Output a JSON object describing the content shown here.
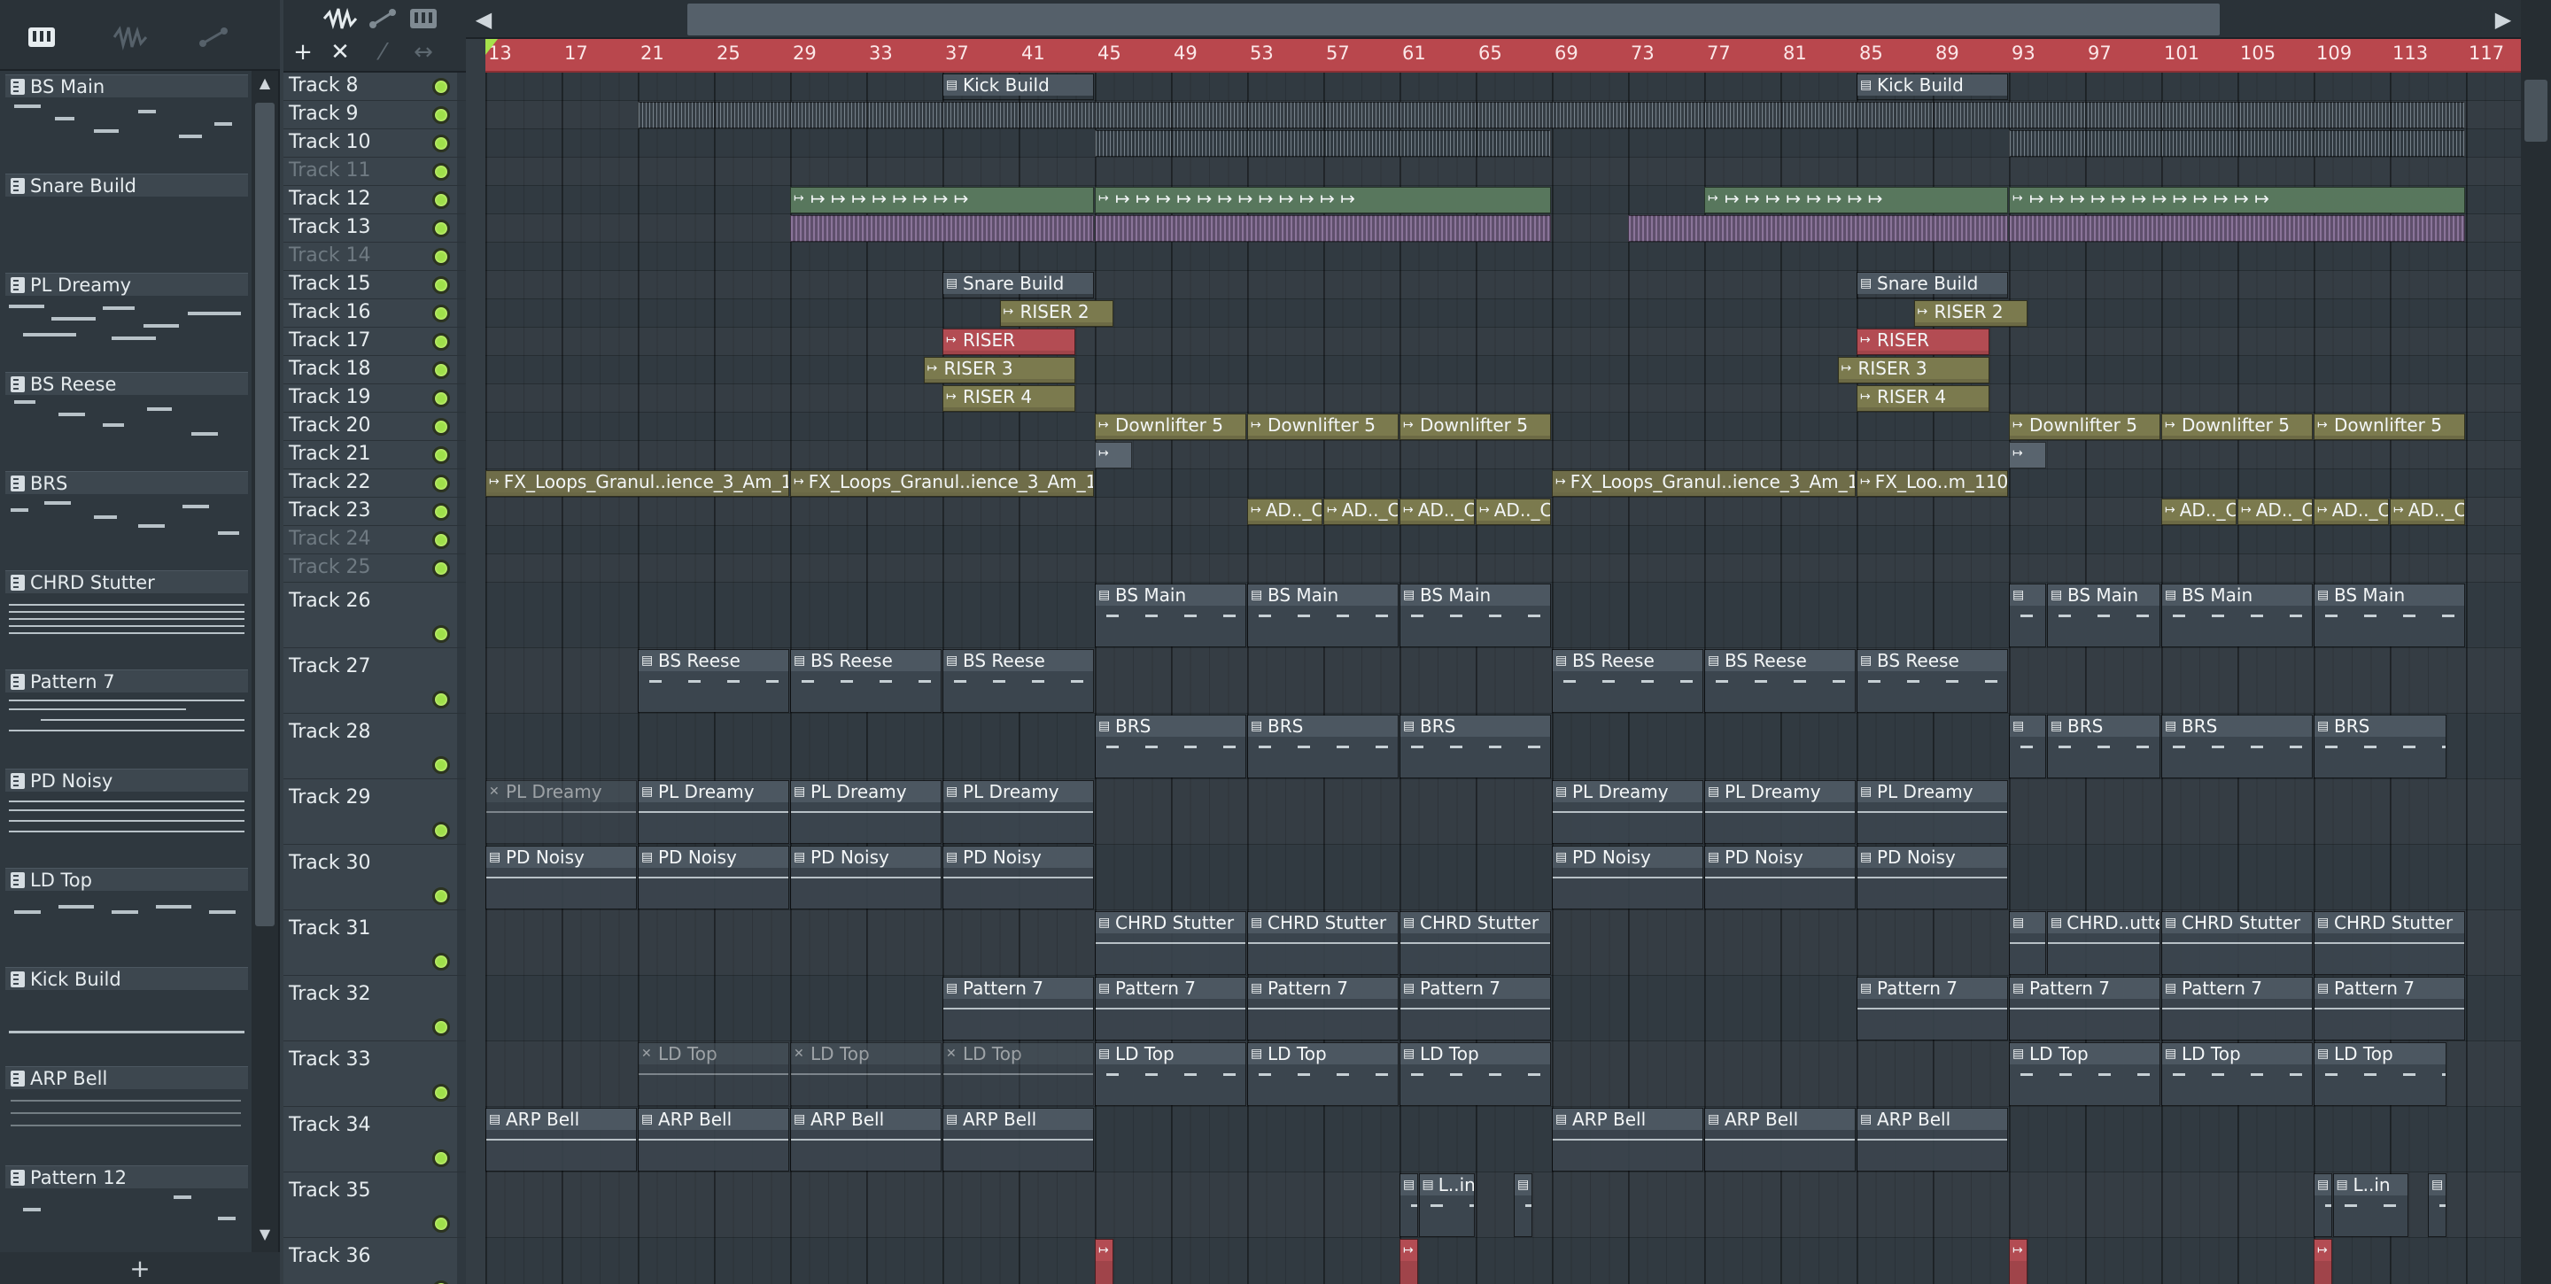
{
  "picker": {
    "patterns": [
      {
        "name": "BS Main"
      },
      {
        "name": "Snare Build"
      },
      {
        "name": "PL Dreamy"
      },
      {
        "name": "BS Reese"
      },
      {
        "name": "BRS"
      },
      {
        "name": "CHRD Stutter"
      },
      {
        "name": "Pattern 7"
      },
      {
        "name": "PD Noisy"
      },
      {
        "name": "LD Top"
      },
      {
        "name": "Kick Build"
      },
      {
        "name": "ARP Bell"
      },
      {
        "name": "Pattern 12"
      }
    ],
    "add_label": "+"
  },
  "toolbar": {
    "add_label": "+",
    "delete_label": "✕"
  },
  "ruler": {
    "bars": [
      "13",
      "17",
      "21",
      "25",
      "29",
      "33",
      "37",
      "41",
      "45",
      "49",
      "53",
      "57",
      "61",
      "65",
      "69",
      "73",
      "77",
      "81",
      "85",
      "89",
      "93",
      "97",
      "101",
      "105",
      "109",
      "113",
      "117"
    ]
  },
  "tracks": [
    {
      "name": "Track 8"
    },
    {
      "name": "Track 9"
    },
    {
      "name": "Track 10"
    },
    {
      "name": "Track 11",
      "dim": true
    },
    {
      "name": "Track 12"
    },
    {
      "name": "Track 13"
    },
    {
      "name": "Track 14",
      "dim": true
    },
    {
      "name": "Track 15"
    },
    {
      "name": "Track 16"
    },
    {
      "name": "Track 17"
    },
    {
      "name": "Track 18"
    },
    {
      "name": "Track 19"
    },
    {
      "name": "Track 20"
    },
    {
      "name": "Track 21"
    },
    {
      "name": "Track 22"
    },
    {
      "name": "Track 23"
    },
    {
      "name": "Track 24",
      "dim": true
    },
    {
      "name": "Track 25",
      "dim": true
    },
    {
      "name": "Track 26"
    },
    {
      "name": "Track 27"
    },
    {
      "name": "Track 28"
    },
    {
      "name": "Track 29"
    },
    {
      "name": "Track 30"
    },
    {
      "name": "Track 31"
    },
    {
      "name": "Track 32"
    },
    {
      "name": "Track 33"
    },
    {
      "name": "Track 34"
    },
    {
      "name": "Track 35"
    },
    {
      "name": "Track 36"
    }
  ],
  "clips": [
    {
      "track": 0,
      "start": 37,
      "len": 8,
      "label": "Kick Build",
      "kind": "pattern"
    },
    {
      "track": 0,
      "start": 85,
      "len": 8,
      "label": "Kick Build",
      "kind": "pattern"
    },
    {
      "track": 1,
      "start": 21,
      "len": 96,
      "label": "",
      "kind": "ticks"
    },
    {
      "track": 2,
      "start": 45,
      "len": 24,
      "label": "",
      "kind": "ticks"
    },
    {
      "track": 2,
      "start": 93,
      "len": 24,
      "label": "",
      "kind": "ticks"
    },
    {
      "track": 4,
      "start": 29,
      "len": 16,
      "label": "↦ ↦ ↦ ↦ ↦ ↦ ↦ ↦",
      "kind": "green"
    },
    {
      "track": 4,
      "start": 45,
      "len": 24,
      "label": "↦ ↦ ↦ ↦ ↦ ↦ ↦ ↦ ↦ ↦ ↦ ↦",
      "kind": "green"
    },
    {
      "track": 4,
      "start": 77,
      "len": 16,
      "label": "↦ ↦ ↦ ↦ ↦ ↦ ↦ ↦",
      "kind": "green"
    },
    {
      "track": 4,
      "start": 93,
      "len": 24,
      "label": "↦ ↦ ↦ ↦ ↦ ↦ ↦ ↦ ↦ ↦ ↦ ↦",
      "kind": "green"
    },
    {
      "track": 5,
      "start": 29,
      "len": 16,
      "label": "",
      "kind": "purple"
    },
    {
      "track": 5,
      "start": 45,
      "len": 24,
      "label": "",
      "kind": "purple"
    },
    {
      "track": 5,
      "start": 73,
      "len": 20,
      "label": "",
      "kind": "purple"
    },
    {
      "track": 5,
      "start": 93,
      "len": 24,
      "label": "",
      "kind": "purple"
    },
    {
      "track": 7,
      "start": 37,
      "len": 8,
      "label": "Snare Build",
      "kind": "pattern"
    },
    {
      "track": 7,
      "start": 85,
      "len": 8,
      "label": "Snare Build",
      "kind": "pattern"
    },
    {
      "track": 8,
      "start": 40,
      "len": 6,
      "label": "RISER 2",
      "kind": "olive"
    },
    {
      "track": 8,
      "start": 88,
      "len": 6,
      "label": "RISER 2",
      "kind": "olive"
    },
    {
      "track": 9,
      "start": 37,
      "len": 7,
      "label": "RISER",
      "kind": "red"
    },
    {
      "track": 9,
      "start": 85,
      "len": 7,
      "label": "RISER",
      "kind": "red"
    },
    {
      "track": 10,
      "start": 36,
      "len": 8,
      "label": "RISER 3",
      "kind": "olive"
    },
    {
      "track": 10,
      "start": 84,
      "len": 8,
      "label": "RISER 3",
      "kind": "olive"
    },
    {
      "track": 11,
      "start": 37,
      "len": 7,
      "label": "RISER 4",
      "kind": "olive"
    },
    {
      "track": 11,
      "start": 85,
      "len": 7,
      "label": "RISER 4",
      "kind": "olive"
    },
    {
      "track": 12,
      "start": 45,
      "len": 8,
      "label": "Downlifter 5",
      "kind": "olive"
    },
    {
      "track": 12,
      "start": 53,
      "len": 8,
      "label": "Downlifter 5",
      "kind": "olive"
    },
    {
      "track": 12,
      "start": 61,
      "len": 8,
      "label": "Downlifter 5",
      "kind": "olive"
    },
    {
      "track": 12,
      "start": 93,
      "len": 8,
      "label": "Downlifter 5",
      "kind": "olive"
    },
    {
      "track": 12,
      "start": 101,
      "len": 8,
      "label": "Downlifter 5",
      "kind": "olive"
    },
    {
      "track": 12,
      "start": 109,
      "len": 8,
      "label": "Downlifter 5",
      "kind": "olive"
    },
    {
      "track": 13,
      "start": 45,
      "len": 2,
      "label": "",
      "kind": "grey"
    },
    {
      "track": 13,
      "start": 93,
      "len": 2,
      "label": "",
      "kind": "grey"
    },
    {
      "track": 14,
      "start": 13,
      "len": 16,
      "label": "FX_Loops_Granul..ience_3_Am_110",
      "kind": "audio"
    },
    {
      "track": 14,
      "start": 29,
      "len": 16,
      "label": "FX_Loops_Granul..ience_3_Am_110",
      "kind": "audio"
    },
    {
      "track": 14,
      "start": 69,
      "len": 16,
      "label": "FX_Loops_Granul..ience_3_Am_110",
      "kind": "audio"
    },
    {
      "track": 14,
      "start": 85,
      "len": 8,
      "label": "FX_Loo..m_110",
      "kind": "audio"
    },
    {
      "track": 15,
      "start": 53,
      "len": 4,
      "label": "AD.._C",
      "kind": "olive"
    },
    {
      "track": 15,
      "start": 57,
      "len": 4,
      "label": "AD.._C",
      "kind": "olive"
    },
    {
      "track": 15,
      "start": 61,
      "len": 4,
      "label": "AD.._C",
      "kind": "olive"
    },
    {
      "track": 15,
      "start": 65,
      "len": 4,
      "label": "AD.._C",
      "kind": "olive"
    },
    {
      "track": 15,
      "start": 101,
      "len": 4,
      "label": "AD.._C",
      "kind": "olive"
    },
    {
      "track": 15,
      "start": 105,
      "len": 4,
      "label": "AD.._C",
      "kind": "olive"
    },
    {
      "track": 15,
      "start": 109,
      "len": 4,
      "label": "AD.._C",
      "kind": "olive"
    },
    {
      "track": 15,
      "start": 113,
      "len": 4,
      "label": "AD.._C",
      "kind": "olive"
    },
    {
      "track": 18,
      "start": 45,
      "len": 8,
      "label": "BS Main",
      "kind": "pattern"
    },
    {
      "track": 18,
      "start": 53,
      "len": 8,
      "label": "BS Main",
      "kind": "pattern"
    },
    {
      "track": 18,
      "start": 61,
      "len": 8,
      "label": "BS Main",
      "kind": "pattern"
    },
    {
      "track": 18,
      "start": 93,
      "len": 2,
      "label": "",
      "kind": "pattern"
    },
    {
      "track": 18,
      "start": 95,
      "len": 6,
      "label": "BS Main",
      "kind": "pattern"
    },
    {
      "track": 18,
      "start": 101,
      "len": 8,
      "label": "BS Main",
      "kind": "pattern"
    },
    {
      "track": 18,
      "start": 109,
      "len": 8,
      "label": "BS Main",
      "kind": "pattern"
    },
    {
      "track": 19,
      "start": 21,
      "len": 8,
      "label": "BS Reese",
      "kind": "pattern"
    },
    {
      "track": 19,
      "start": 29,
      "len": 8,
      "label": "BS Reese",
      "kind": "pattern"
    },
    {
      "track": 19,
      "start": 37,
      "len": 8,
      "label": "BS Reese",
      "kind": "pattern"
    },
    {
      "track": 19,
      "start": 69,
      "len": 8,
      "label": "BS Reese",
      "kind": "pattern"
    },
    {
      "track": 19,
      "start": 77,
      "len": 8,
      "label": "BS Reese",
      "kind": "pattern"
    },
    {
      "track": 19,
      "start": 85,
      "len": 8,
      "label": "BS Reese",
      "kind": "pattern"
    },
    {
      "track": 20,
      "start": 45,
      "len": 8,
      "label": "BRS",
      "kind": "pattern"
    },
    {
      "track": 20,
      "start": 53,
      "len": 8,
      "label": "BRS",
      "kind": "pattern"
    },
    {
      "track": 20,
      "start": 61,
      "len": 8,
      "label": "BRS",
      "kind": "pattern"
    },
    {
      "track": 20,
      "start": 93,
      "len": 2,
      "label": "",
      "kind": "pattern"
    },
    {
      "track": 20,
      "start": 95,
      "len": 6,
      "label": "BRS",
      "kind": "pattern"
    },
    {
      "track": 20,
      "start": 101,
      "len": 8,
      "label": "BRS",
      "kind": "pattern"
    },
    {
      "track": 20,
      "start": 109,
      "len": 7,
      "label": "BRS",
      "kind": "pattern"
    },
    {
      "track": 21,
      "start": 13,
      "len": 8,
      "label": "PL Dreamy",
      "kind": "pattern-muted"
    },
    {
      "track": 21,
      "start": 21,
      "len": 8,
      "label": "PL Dreamy",
      "kind": "pattern-dense"
    },
    {
      "track": 21,
      "start": 29,
      "len": 8,
      "label": "PL Dreamy",
      "kind": "pattern-dense"
    },
    {
      "track": 21,
      "start": 37,
      "len": 8,
      "label": "PL Dreamy",
      "kind": "pattern-dense"
    },
    {
      "track": 21,
      "start": 69,
      "len": 8,
      "label": "PL Dreamy",
      "kind": "pattern-dense"
    },
    {
      "track": 21,
      "start": 77,
      "len": 8,
      "label": "PL Dreamy",
      "kind": "pattern-dense"
    },
    {
      "track": 21,
      "start": 85,
      "len": 8,
      "label": "PL Dreamy",
      "kind": "pattern-dense"
    },
    {
      "track": 22,
      "start": 13,
      "len": 8,
      "label": "PD Noisy",
      "kind": "pattern-dense"
    },
    {
      "track": 22,
      "start": 21,
      "len": 8,
      "label": "PD Noisy",
      "kind": "pattern-dense"
    },
    {
      "track": 22,
      "start": 29,
      "len": 8,
      "label": "PD Noisy",
      "kind": "pattern-dense"
    },
    {
      "track": 22,
      "start": 37,
      "len": 8,
      "label": "PD Noisy",
      "kind": "pattern-dense"
    },
    {
      "track": 22,
      "start": 69,
      "len": 8,
      "label": "PD Noisy",
      "kind": "pattern-dense"
    },
    {
      "track": 22,
      "start": 77,
      "len": 8,
      "label": "PD Noisy",
      "kind": "pattern-dense"
    },
    {
      "track": 22,
      "start": 85,
      "len": 8,
      "label": "PD Noisy",
      "kind": "pattern-dense"
    },
    {
      "track": 23,
      "start": 45,
      "len": 8,
      "label": "CHRD Stutter",
      "kind": "pattern-dense"
    },
    {
      "track": 23,
      "start": 53,
      "len": 8,
      "label": "CHRD Stutter",
      "kind": "pattern-dense"
    },
    {
      "track": 23,
      "start": 61,
      "len": 8,
      "label": "CHRD Stutter",
      "kind": "pattern-dense"
    },
    {
      "track": 23,
      "start": 93,
      "len": 2,
      "label": "",
      "kind": "pattern-dense"
    },
    {
      "track": 23,
      "start": 95,
      "len": 6,
      "label": "CHRD..utter",
      "kind": "pattern-dense"
    },
    {
      "track": 23,
      "start": 101,
      "len": 8,
      "label": "CHRD Stutter",
      "kind": "pattern-dense"
    },
    {
      "track": 23,
      "start": 109,
      "len": 8,
      "label": "CHRD Stutter",
      "kind": "pattern-dense"
    },
    {
      "track": 24,
      "start": 37,
      "len": 8,
      "label": "Pattern 7",
      "kind": "pattern-dense"
    },
    {
      "track": 24,
      "start": 45,
      "len": 8,
      "label": "Pattern 7",
      "kind": "pattern-dense"
    },
    {
      "track": 24,
      "start": 53,
      "len": 8,
      "label": "Pattern 7",
      "kind": "pattern-dense"
    },
    {
      "track": 24,
      "start": 61,
      "len": 8,
      "label": "Pattern 7",
      "kind": "pattern-dense"
    },
    {
      "track": 24,
      "start": 85,
      "len": 8,
      "label": "Pattern 7",
      "kind": "pattern-dense"
    },
    {
      "track": 24,
      "start": 93,
      "len": 8,
      "label": "Pattern 7",
      "kind": "pattern-dense"
    },
    {
      "track": 24,
      "start": 101,
      "len": 8,
      "label": "Pattern 7",
      "kind": "pattern-dense"
    },
    {
      "track": 24,
      "start": 109,
      "len": 8,
      "label": "Pattern 7",
      "kind": "pattern-dense"
    },
    {
      "track": 25,
      "start": 21,
      "len": 8,
      "label": "LD Top",
      "kind": "pattern-muted"
    },
    {
      "track": 25,
      "start": 29,
      "len": 8,
      "label": "LD Top",
      "kind": "pattern-muted"
    },
    {
      "track": 25,
      "start": 37,
      "len": 8,
      "label": "LD Top",
      "kind": "pattern-muted"
    },
    {
      "track": 25,
      "start": 45,
      "len": 8,
      "label": "LD Top",
      "kind": "pattern"
    },
    {
      "track": 25,
      "start": 53,
      "len": 8,
      "label": "LD Top",
      "kind": "pattern"
    },
    {
      "track": 25,
      "start": 61,
      "len": 8,
      "label": "LD Top",
      "kind": "pattern"
    },
    {
      "track": 25,
      "start": 93,
      "len": 8,
      "label": "LD Top",
      "kind": "pattern"
    },
    {
      "track": 25,
      "start": 101,
      "len": 8,
      "label": "LD Top",
      "kind": "pattern"
    },
    {
      "track": 25,
      "start": 109,
      "len": 7,
      "label": "LD Top",
      "kind": "pattern"
    },
    {
      "track": 26,
      "start": 13,
      "len": 8,
      "label": "ARP Bell",
      "kind": "pattern-dense"
    },
    {
      "track": 26,
      "start": 21,
      "len": 8,
      "label": "ARP Bell",
      "kind": "pattern-dense"
    },
    {
      "track": 26,
      "start": 29,
      "len": 8,
      "label": "ARP Bell",
      "kind": "pattern-dense"
    },
    {
      "track": 26,
      "start": 37,
      "len": 8,
      "label": "ARP Bell",
      "kind": "pattern-dense"
    },
    {
      "track": 26,
      "start": 69,
      "len": 8,
      "label": "ARP Bell",
      "kind": "pattern-dense"
    },
    {
      "track": 26,
      "start": 77,
      "len": 8,
      "label": "ARP Bell",
      "kind": "pattern-dense"
    },
    {
      "track": 26,
      "start": 85,
      "len": 8,
      "label": "ARP Bell",
      "kind": "pattern-dense"
    },
    {
      "track": 27,
      "start": 61,
      "len": 1,
      "label": "",
      "kind": "pattern"
    },
    {
      "track": 27,
      "start": 62,
      "len": 3,
      "label": "L..in",
      "kind": "pattern"
    },
    {
      "track": 27,
      "start": 67,
      "len": 1,
      "label": "",
      "kind": "pattern"
    },
    {
      "track": 27,
      "start": 109,
      "len": 1,
      "label": "",
      "kind": "pattern"
    },
    {
      "track": 27,
      "start": 110,
      "len": 4,
      "label": "L..in",
      "kind": "pattern"
    },
    {
      "track": 27,
      "start": 115,
      "len": 1,
      "label": "",
      "kind": "pattern"
    },
    {
      "track": 28,
      "start": 45,
      "len": 1,
      "label": "",
      "kind": "red"
    },
    {
      "track": 28,
      "start": 61,
      "len": 1,
      "label": "",
      "kind": "red"
    },
    {
      "track": 28,
      "start": 93,
      "len": 1,
      "label": "",
      "kind": "red"
    },
    {
      "track": 28,
      "start": 109,
      "len": 1,
      "label": "",
      "kind": "red"
    }
  ]
}
